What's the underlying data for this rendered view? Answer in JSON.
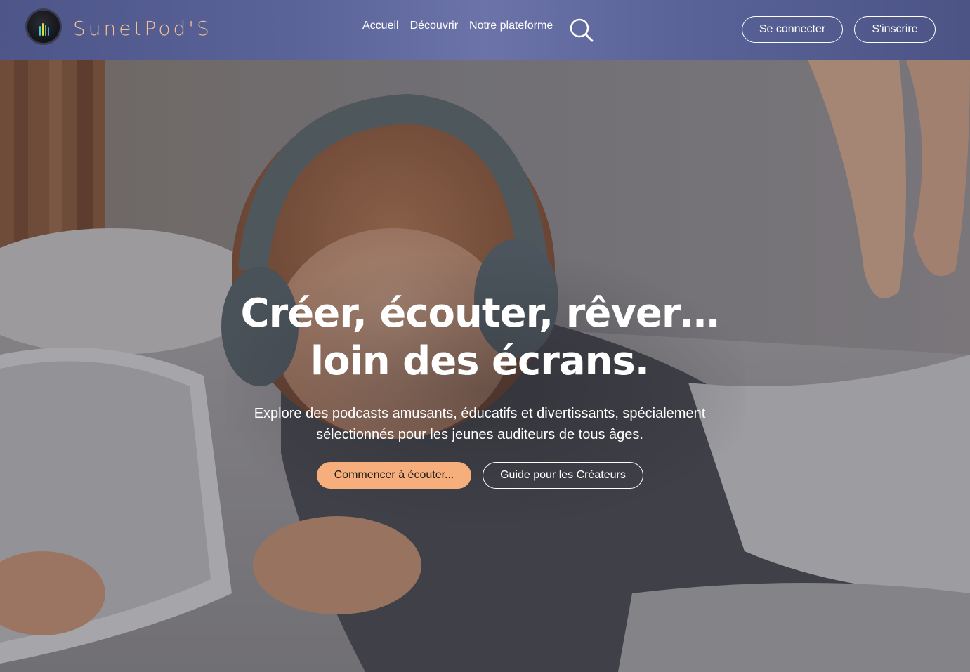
{
  "brand": {
    "name": "SunetPod'S",
    "logo_icon": "equalizer-bars-icon",
    "colors": {
      "accent": "#f5ae7c",
      "logo_text": "#f2c18f",
      "header": "#5a6398"
    }
  },
  "nav": {
    "items": [
      {
        "label": "Accueil"
      },
      {
        "label": "Découvrir"
      },
      {
        "label": "Notre plateforme"
      }
    ],
    "search_icon": "search-icon"
  },
  "auth": {
    "login_label": "Se connecter",
    "signup_label": "S'inscrire"
  },
  "hero": {
    "title_line1": "Créer, écouter, rêver…",
    "title_line2": "loin des écrans.",
    "subtitle": "Explore des podcasts amusants, éducatifs et divertissants, spécialement sélectionnés pour les jeunes auditeurs de tous âges.",
    "cta_primary": "Commencer à écouter...",
    "cta_secondary": "Guide pour les Créateurs",
    "background": "child-with-headphones-photo"
  }
}
